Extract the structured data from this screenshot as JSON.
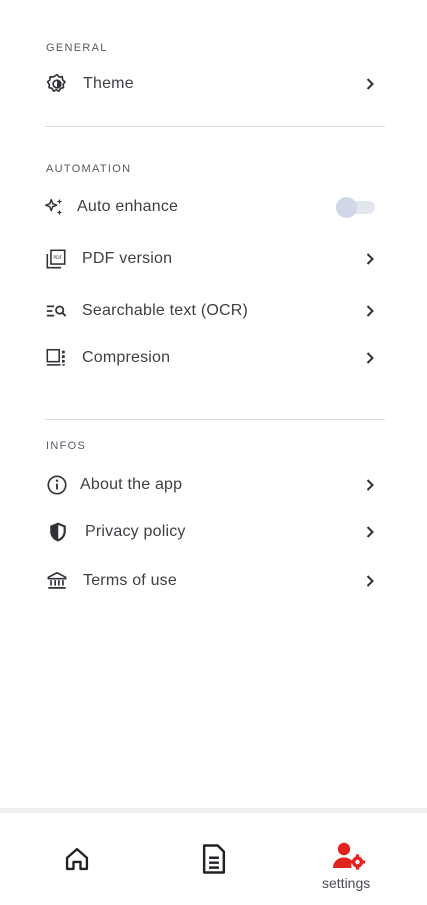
{
  "sections": {
    "general": {
      "title": "GENERAL"
    },
    "automation": {
      "title": "AUTOMATION"
    },
    "infos": {
      "title": "INFOS"
    }
  },
  "items": {
    "theme": {
      "label": "Theme",
      "icon": "theme-icon"
    },
    "auto_enhance": {
      "label": "Auto enhance",
      "icon": "sparkle-icon",
      "enabled": false
    },
    "pdf_version": {
      "label": "PDF version",
      "icon": "pdf-icon"
    },
    "ocr": {
      "label": "Searchable text (OCR)",
      "icon": "ocr-icon"
    },
    "compression": {
      "label": "Compresion",
      "icon": "compression-icon"
    },
    "about": {
      "label": "About the app",
      "icon": "info-icon"
    },
    "privacy": {
      "label": "Privacy policy",
      "icon": "shield-icon"
    },
    "terms": {
      "label": "Terms of use",
      "icon": "bank-icon"
    }
  },
  "bottom_nav": {
    "home": {
      "icon": "home-icon"
    },
    "documents": {
      "icon": "document-icon"
    },
    "settings": {
      "label": "settings",
      "icon": "user-settings-icon",
      "active": true
    }
  },
  "colors": {
    "accent": "#e1241d",
    "text": "#3c3f44",
    "divider": "#d9dbdf",
    "toggle_off": "#cfd8e6"
  }
}
